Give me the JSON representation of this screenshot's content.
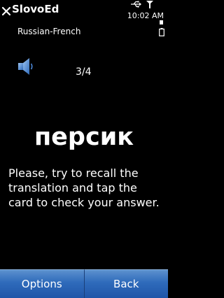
{
  "header": {
    "title": "SlovoEd",
    "subtitle": "Russian-French"
  },
  "status": {
    "time": "10:02 AM"
  },
  "card": {
    "counter": "3/4",
    "word": "персик",
    "instruction": "Please, try to recall the translation and tap the card to check your answer."
  },
  "softkeys": {
    "left": "Options",
    "right": "Back"
  },
  "icons": {
    "close": "close-icon",
    "usb": "usb-icon",
    "signal": "signal-icon",
    "battery": "battery-icon",
    "speaker": "speaker-icon"
  },
  "colors": {
    "background": "#000000",
    "softkey": "#2f6bbb",
    "speaker": "#4a86d6"
  }
}
